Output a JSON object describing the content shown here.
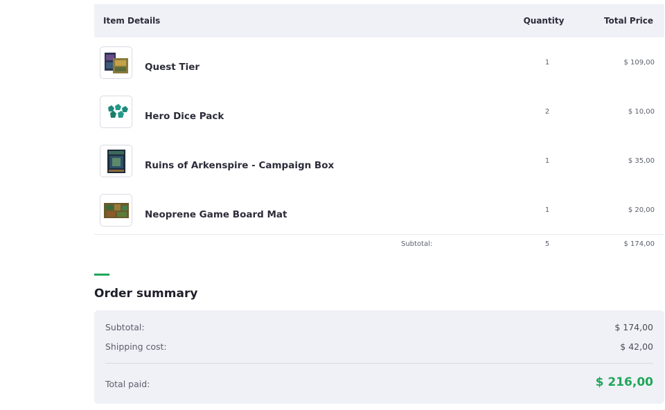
{
  "table": {
    "headers": {
      "item": "Item Details",
      "quantity": "Quantity",
      "total": "Total Price"
    },
    "items": [
      {
        "name": "Quest Tier",
        "quantity": "1",
        "price": "$ 109,00",
        "thumb": "box-stack-icon"
      },
      {
        "name": "Hero Dice Pack",
        "quantity": "2",
        "price": "$ 10,00",
        "thumb": "dice-icon"
      },
      {
        "name": "Ruins of Arkenspire - Campaign Box",
        "quantity": "1",
        "price": "$ 35,00",
        "thumb": "game-box-icon"
      },
      {
        "name": "Neoprene Game Board Mat",
        "quantity": "1",
        "price": "$ 20,00",
        "thumb": "board-mat-icon"
      }
    ],
    "subtotal": {
      "label": "Subtotal:",
      "quantity": "5",
      "price": "$ 174,00"
    }
  },
  "summary": {
    "title": "Order summary",
    "subtotal_label": "Subtotal:",
    "subtotal_value": "$ 174,00",
    "shipping_label": "Shipping cost:",
    "shipping_value": "$ 42,00",
    "total_label": "Total paid:",
    "total_value": "$ 216,00"
  },
  "colors": {
    "accent": "#1ea65a",
    "panel": "#f0f1f6",
    "text": "#2c2c3a"
  }
}
